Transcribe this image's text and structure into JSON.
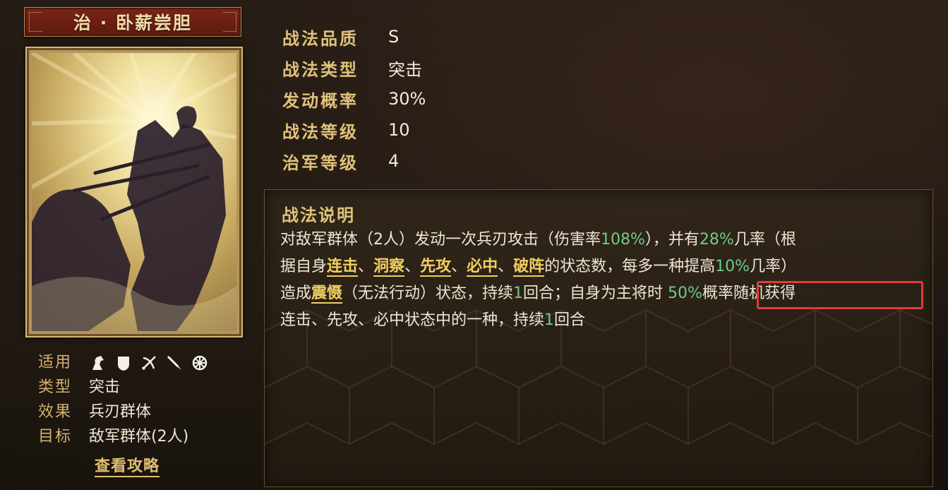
{
  "skill": {
    "title": "治 · 卧薪尝胆"
  },
  "stats": [
    {
      "label": "战法品质",
      "value": "S"
    },
    {
      "label": "战法类型",
      "value": "突击"
    },
    {
      "label": "发动概率",
      "value": "30%"
    },
    {
      "label": "战法等级",
      "value": "10"
    },
    {
      "label": "治军等级",
      "value": "4"
    }
  ],
  "info": {
    "applicable_label": "适用",
    "unit_icons": [
      "cavalry-icon",
      "shield-icon",
      "archer-icon",
      "spear-icon",
      "siege-icon"
    ],
    "type_label": "类型",
    "type_value": "突击",
    "effect_label": "效果",
    "effect_value": "兵刃群体",
    "target_label": "目标",
    "target_value": "敌军群体(2人)",
    "strategy_link": "查看攻略"
  },
  "description": {
    "title": "战法说明",
    "lines": [
      [
        {
          "t": "对敌军群体（2人）发动一次兵刃攻击（伤害率"
        },
        {
          "t": "108%",
          "c": "num"
        },
        {
          "t": "），并有"
        },
        {
          "t": "28%",
          "c": "num"
        },
        {
          "t": "几率（根"
        }
      ],
      [
        {
          "t": "据自身"
        },
        {
          "t": "连击",
          "c": "kw"
        },
        {
          "t": "、"
        },
        {
          "t": "洞察",
          "c": "kw"
        },
        {
          "t": "、"
        },
        {
          "t": "先攻",
          "c": "kw"
        },
        {
          "t": "、"
        },
        {
          "t": "必中",
          "c": "kw"
        },
        {
          "t": "、"
        },
        {
          "t": "破阵",
          "c": "kw"
        },
        {
          "t": "的状态数，每多一种提高"
        },
        {
          "t": "10%",
          "c": "num"
        },
        {
          "t": "几率）"
        }
      ],
      [
        {
          "t": "造成"
        },
        {
          "t": "震慑",
          "c": "kw"
        },
        {
          "t": "（无法行动）状态，持续"
        },
        {
          "t": "1",
          "c": "num"
        },
        {
          "t": "回合；自身为主将时  "
        },
        {
          "t": "50%",
          "c": "num"
        },
        {
          "t": "概率随机获得"
        }
      ],
      [
        {
          "t": "连击、先攻、必中状态中的一种，持续"
        },
        {
          "t": "1",
          "c": "num"
        },
        {
          "t": "回合"
        }
      ]
    ]
  },
  "colors": {
    "label_gold": "#e0c278",
    "number_green": "#6fcb88",
    "keyword_yellow": "#f1cf5f",
    "highlight_box_red": "#e43a3a",
    "title_plate_red": "#7a2417"
  }
}
